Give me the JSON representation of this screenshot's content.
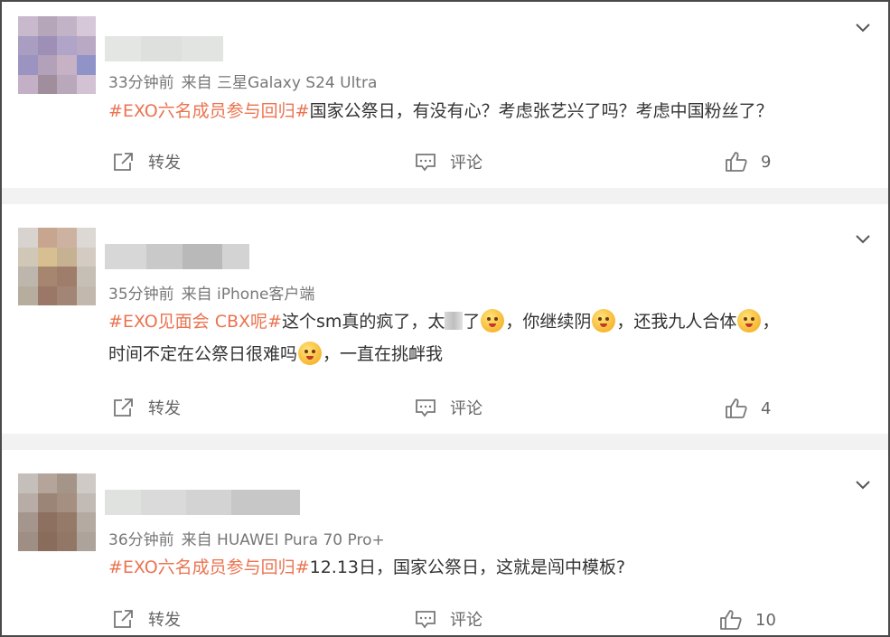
{
  "comments": [
    {
      "time": "33分钟前",
      "source": "来自 三星Galaxy S24 Ultra",
      "hashtag": "#EXO六名成员参与回归#",
      "text": "国家公祭日，有没有心？考虑张艺兴了吗？考虑中国粉丝了？",
      "repost_label": "转发",
      "comment_label": "评论",
      "likes": "9"
    },
    {
      "time": "35分钟前",
      "source": "来自 iPhone客户端",
      "hashtag": "#EXO见面会 CBX呢#",
      "text_a": "这个sm真的疯了，太",
      "text_b": "了",
      "text_c": "，你继续阴",
      "text_d": "，还我九人合体",
      "text_e": "，",
      "text_f": "时间不定在公祭日很难吗",
      "text_g": "，一直在挑衅我",
      "repost_label": "转发",
      "comment_label": "评论",
      "likes": "4"
    },
    {
      "time": "36分钟前",
      "source": "来自 HUAWEI Pura 70 Pro+",
      "hashtag": "#EXO六名成员参与回归#",
      "text": "12.13日，国家公祭日，这就是闯中模板?",
      "repost_label": "转发",
      "comment_label": "评论",
      "likes": "10"
    }
  ],
  "colors": {
    "hashtag": "#eb7350",
    "meta": "#777777",
    "divider": "#f2f2f2"
  },
  "icons": [
    "chevron-down-icon",
    "share-icon",
    "comment-icon",
    "thumbs-up-icon",
    "emoji-icon"
  ]
}
